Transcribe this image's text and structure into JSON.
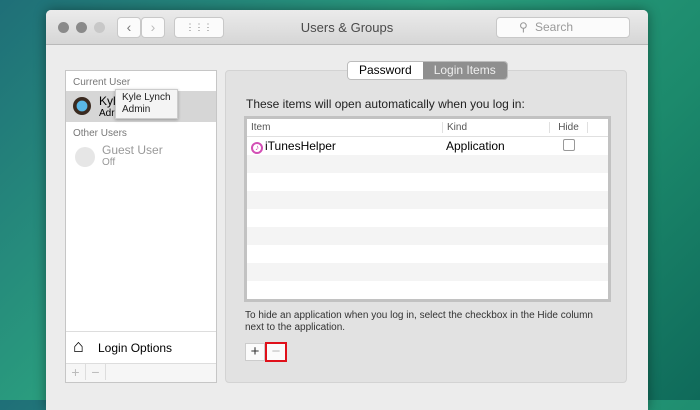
{
  "window": {
    "title": "Users & Groups",
    "search_placeholder": "Search",
    "back": "‹",
    "forward": "›",
    "grid": "⋮⋮⋮"
  },
  "sidebar": {
    "current_user_header": "Current User",
    "current_user": {
      "name": "Kyle Lynch",
      "role": "Admin",
      "name_short": "Kyl",
      "role_short": "Adr"
    },
    "other_users_header": "Other Users",
    "other_users": [
      {
        "name": "Guest User",
        "status": "Off"
      }
    ],
    "login_options": "Login Options",
    "add": "+",
    "remove": "−"
  },
  "tooltip": {
    "name": "Kyle Lynch",
    "role": "Admin"
  },
  "tabs": [
    {
      "label": "Password",
      "active": false
    },
    {
      "label": "Login Items",
      "active": true
    }
  ],
  "main": {
    "heading": "These items will open automatically when you log in:",
    "columns": [
      "Item",
      "Kind",
      "Hide"
    ],
    "rows": [
      {
        "item": "iTunesHelper",
        "kind": "Application",
        "hide": false
      }
    ],
    "note": "To hide an application when you log in, select the checkbox in the Hide column next to the application.",
    "add": "+",
    "remove": "−",
    "highlight_color": "#e0101a"
  }
}
